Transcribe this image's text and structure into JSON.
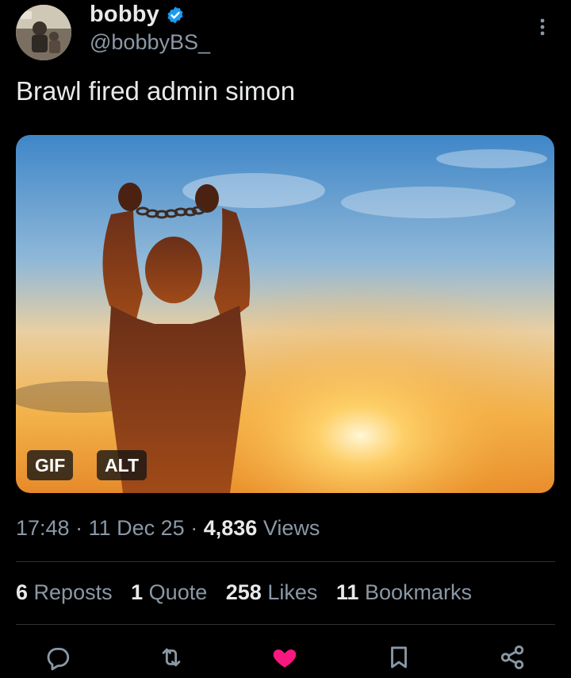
{
  "author": {
    "display_name": "bobby",
    "handle": "@bobbyBS_",
    "verified": true
  },
  "tweet": {
    "text": "Brawl fired admin simon",
    "media": {
      "badges": {
        "gif": "GIF",
        "alt": "ALT"
      }
    }
  },
  "meta": {
    "time": "17:48",
    "separator": "·",
    "date": "11 Dec 25",
    "views_count": "4,836",
    "views_label": "Views"
  },
  "stats": {
    "reposts": {
      "count": "6",
      "label": "Reposts"
    },
    "quotes": {
      "count": "1",
      "label": "Quote"
    },
    "likes": {
      "count": "258",
      "label": "Likes"
    },
    "bookmarks": {
      "count": "11",
      "label": "Bookmarks"
    }
  },
  "actions": [
    "reply-icon",
    "retweet-icon",
    "heart-icon",
    "bookmark-icon",
    "share-icon"
  ],
  "colors": {
    "background": "#000000",
    "text": "#e7e9ea",
    "muted": "#8b98a5",
    "verified": "#1d9bf0",
    "liked": "#f91880"
  }
}
